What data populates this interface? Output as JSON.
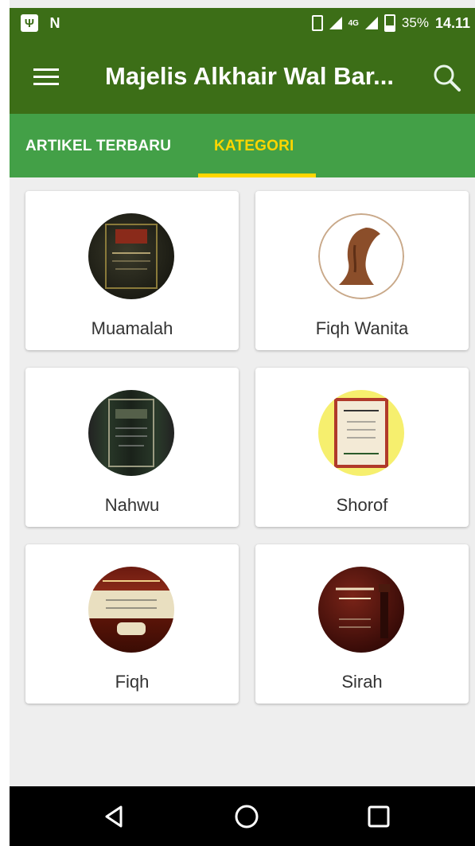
{
  "status_bar": {
    "battery": "35%",
    "network": "4G",
    "time": "14.11"
  },
  "app_bar": {
    "title": "Majelis Alkhair Wal Bar..."
  },
  "tabs": [
    {
      "label": "ARTIKEL TERBARU",
      "active": false
    },
    {
      "label": "KATEGORI",
      "active": true
    }
  ],
  "categories": [
    {
      "label": "Muamalah",
      "image_style": "dark"
    },
    {
      "label": "Fiqh Wanita",
      "image_style": "white"
    },
    {
      "label": "Nahwu",
      "image_style": "green"
    },
    {
      "label": "Shorof",
      "image_style": "yellow"
    },
    {
      "label": "Fiqh",
      "image_style": "cream"
    },
    {
      "label": "Sirah",
      "image_style": "maroon"
    }
  ],
  "colors": {
    "toolbar": "#3c6e17",
    "tab_bar": "#43a047",
    "tab_active": "#ffd600",
    "background": "#eeeeee"
  }
}
